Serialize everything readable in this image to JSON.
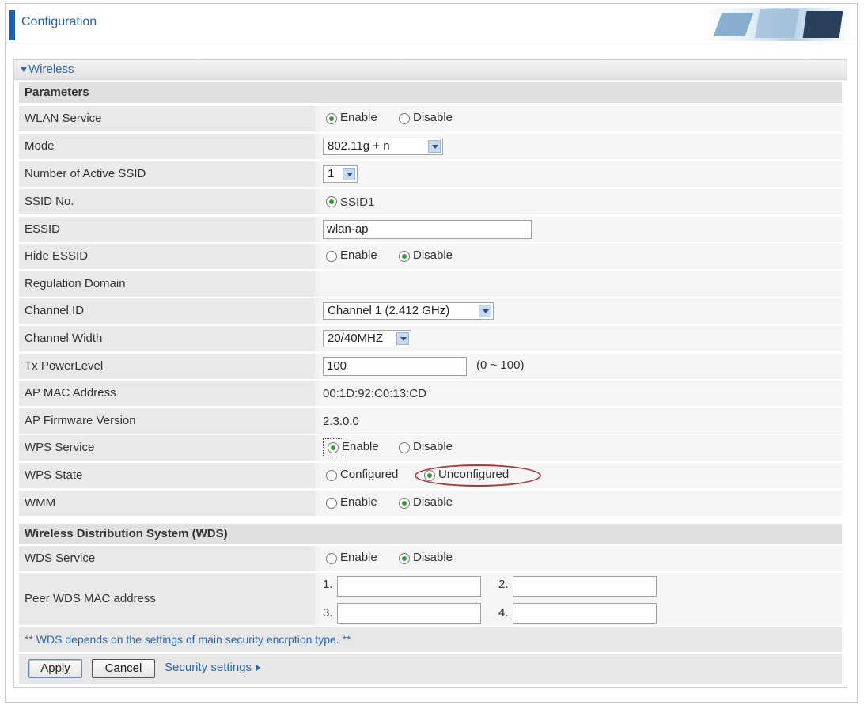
{
  "header": {
    "title": "Configuration"
  },
  "section": {
    "title": "Wireless"
  },
  "groups": {
    "parameters": "Parameters",
    "wds": "Wireless Distribution System (WDS)"
  },
  "labels": {
    "wlan_service": "WLAN Service",
    "mode": "Mode",
    "num_ssid": "Number of Active SSID",
    "ssid_no": "SSID No.",
    "essid": "ESSID",
    "hide_essid": "Hide ESSID",
    "regulation": "Regulation Domain",
    "channel_id": "Channel ID",
    "channel_width": "Channel Width",
    "tx_power": "Tx PowerLevel",
    "ap_mac": "AP MAC Address",
    "ap_fw": "AP Firmware Version",
    "wps_service": "WPS Service",
    "wps_state": "WPS State",
    "wmm": "WMM",
    "wds_service": "WDS Service",
    "peer_wds": "Peer WDS MAC address"
  },
  "options": {
    "enable": "Enable",
    "disable": "Disable",
    "ssid1": "SSID1",
    "configured": "Configured",
    "unconfigured": "Unconfigured"
  },
  "values": {
    "mode": "802.11g + n",
    "num_ssid": "1",
    "essid": "wlan-ap",
    "channel_id": "Channel 1 (2.412 GHz)",
    "channel_width": "20/40MHZ",
    "tx_power": "100",
    "tx_range": "(0 ~ 100)",
    "ap_mac": "00:1D:92:C0:13:CD",
    "ap_fw": "2.3.0.0"
  },
  "peer_labels": [
    "1.",
    "2.",
    "3.",
    "4."
  ],
  "note": "** WDS depends on the settings of main security encrption type. **",
  "buttons": {
    "apply": "Apply",
    "cancel": "Cancel"
  },
  "link": {
    "security": "Security settings"
  }
}
